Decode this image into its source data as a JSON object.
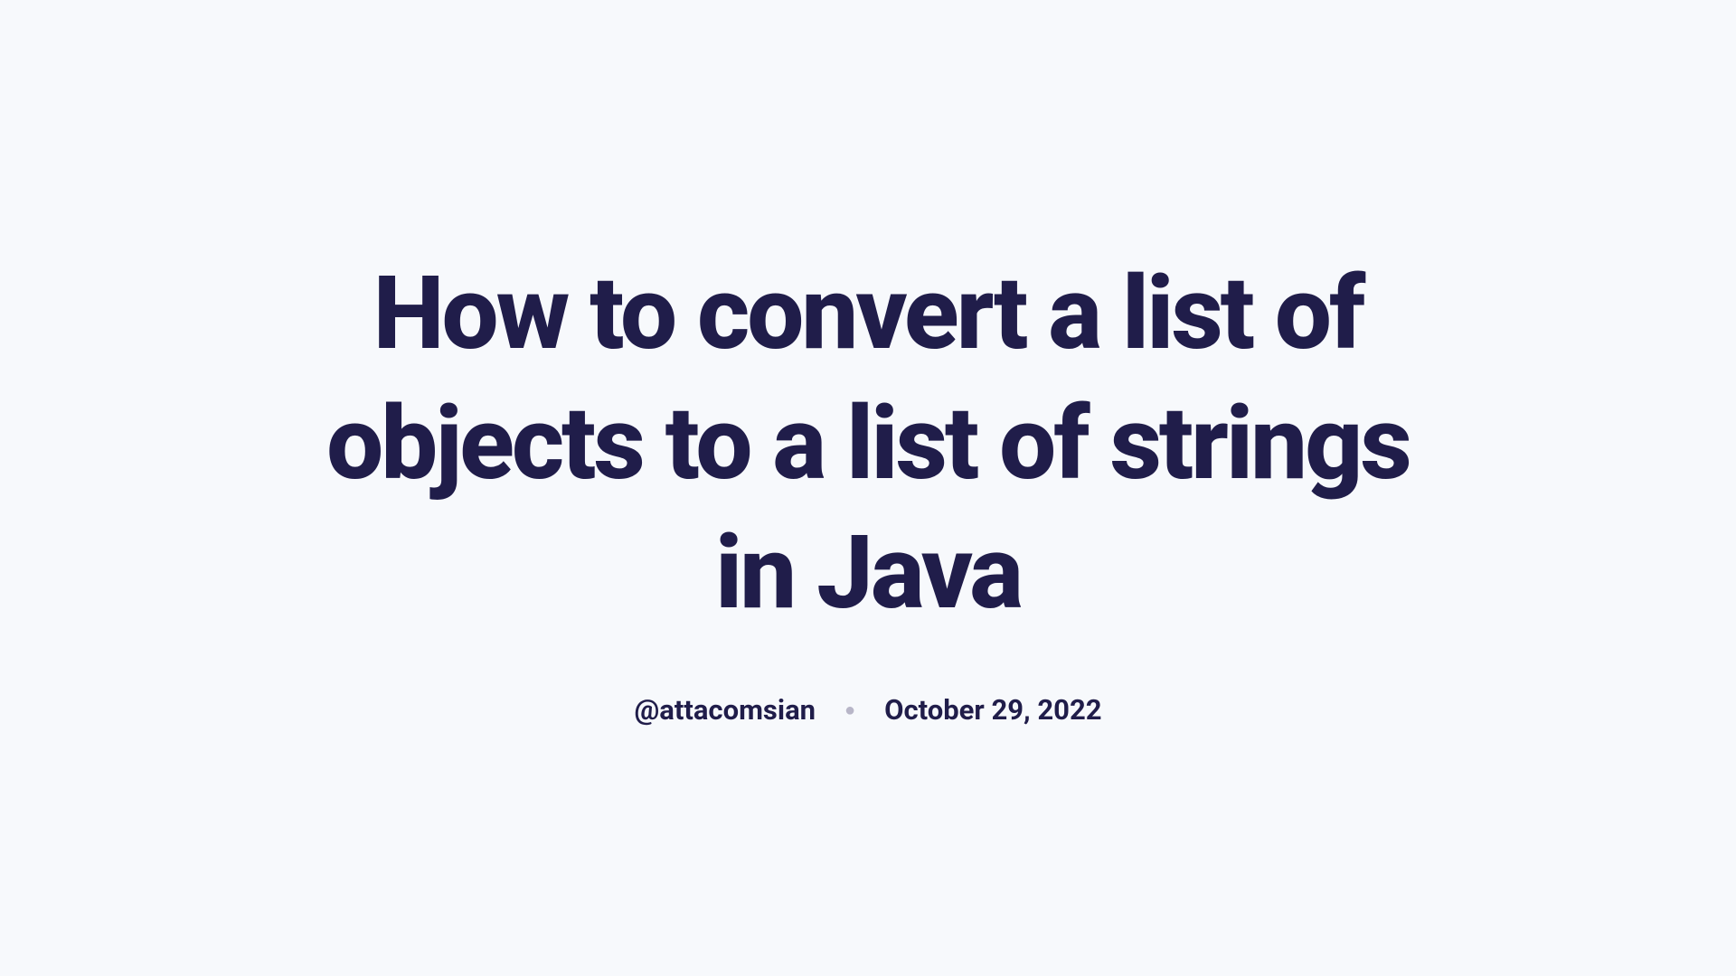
{
  "article": {
    "title": "How to convert a list of objects to a list of strings in Java",
    "author": "@attacomsian",
    "date": "October 29, 2022"
  }
}
